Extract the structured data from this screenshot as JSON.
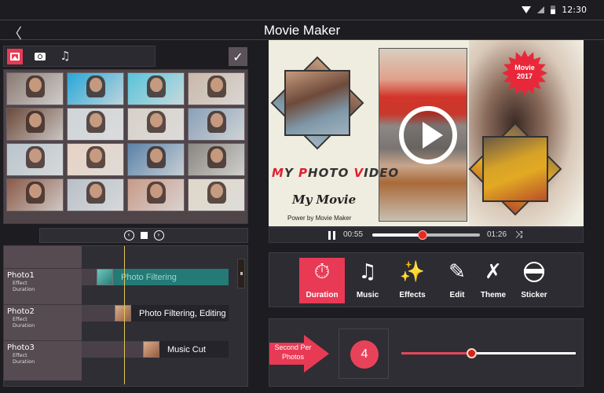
{
  "status_bar": {
    "time": "12:30",
    "icons": [
      "wifi-icon",
      "signal-icon",
      "battery-icon"
    ]
  },
  "header": {
    "title": "Movie Maker",
    "back_icon": "chevron-left-icon"
  },
  "media_tabs": [
    {
      "name": "photos",
      "icon": "image-icon",
      "active": true
    },
    {
      "name": "camera",
      "icon": "camera-icon",
      "active": false
    },
    {
      "name": "music",
      "icon": "music-note-icon",
      "active": false
    }
  ],
  "confirm_icon": "checkmark-icon",
  "photo_grid": {
    "rows": 4,
    "cols": 4,
    "tints": [
      [
        "#8a7a72",
        "#27a7d8",
        "#57c4da",
        "#c9b8a8"
      ],
      [
        "#6b4a3a",
        "#cfd4d8",
        "#d8d0c8",
        "#8aa0b8"
      ],
      [
        "#b8c4cc",
        "#e8d2c4",
        "#5a82a8",
        "#8a8680"
      ],
      [
        "#8a5a48",
        "#b8c0c8",
        "#c89a88",
        "#e0d8c8"
      ]
    ]
  },
  "mini_controls": {
    "prev": "‹",
    "next": "›"
  },
  "timeline": {
    "sub_labels": [
      "Effect",
      "Duration"
    ],
    "rows": [
      {
        "name": "Photo1",
        "clip": "Photo Filtering",
        "style": "teal"
      },
      {
        "name": "Photo2",
        "clip": "Photo Filtering, Editing",
        "style": "dark"
      },
      {
        "name": "Photo3",
        "clip": "Music Cut",
        "style": "dark"
      }
    ]
  },
  "preview": {
    "headline_parts": [
      "M",
      "Y ",
      "P",
      "HOTO ",
      "V",
      "IDEO"
    ],
    "subtitle": "My Movie",
    "credit": "Power by Movie Maker",
    "badge": [
      "Movie",
      "2017"
    ]
  },
  "player": {
    "current_time": "00:55",
    "total_time": "01:26",
    "progress": 0.47,
    "shuffle_icon": "⤨"
  },
  "tools": [
    {
      "label": "Duration",
      "icon": "stopwatch-icon",
      "glyph": "⏱",
      "active": true
    },
    {
      "label": "Music",
      "icon": "music-note-icon",
      "glyph": "♫",
      "active": false
    },
    {
      "label": "Effects",
      "icon": "magic-wand-icon",
      "glyph": "✨",
      "active": false
    },
    {
      "label": "Edit",
      "icon": "pencil-icon",
      "glyph": "✎",
      "active": false
    },
    {
      "label": "Theme",
      "icon": "ruler-pencil-icon",
      "glyph": "✗",
      "active": false
    },
    {
      "label": "Sticker",
      "icon": "ninja-face-icon",
      "glyph": "",
      "active": false
    }
  ],
  "duration": {
    "label_line1": "Second Per",
    "label_line2": "Photos",
    "value": "4",
    "slider_fraction": 0.4
  },
  "colors": {
    "accent": "#e83a55",
    "teal": "#237a76",
    "playhead": "#e1c85a"
  }
}
